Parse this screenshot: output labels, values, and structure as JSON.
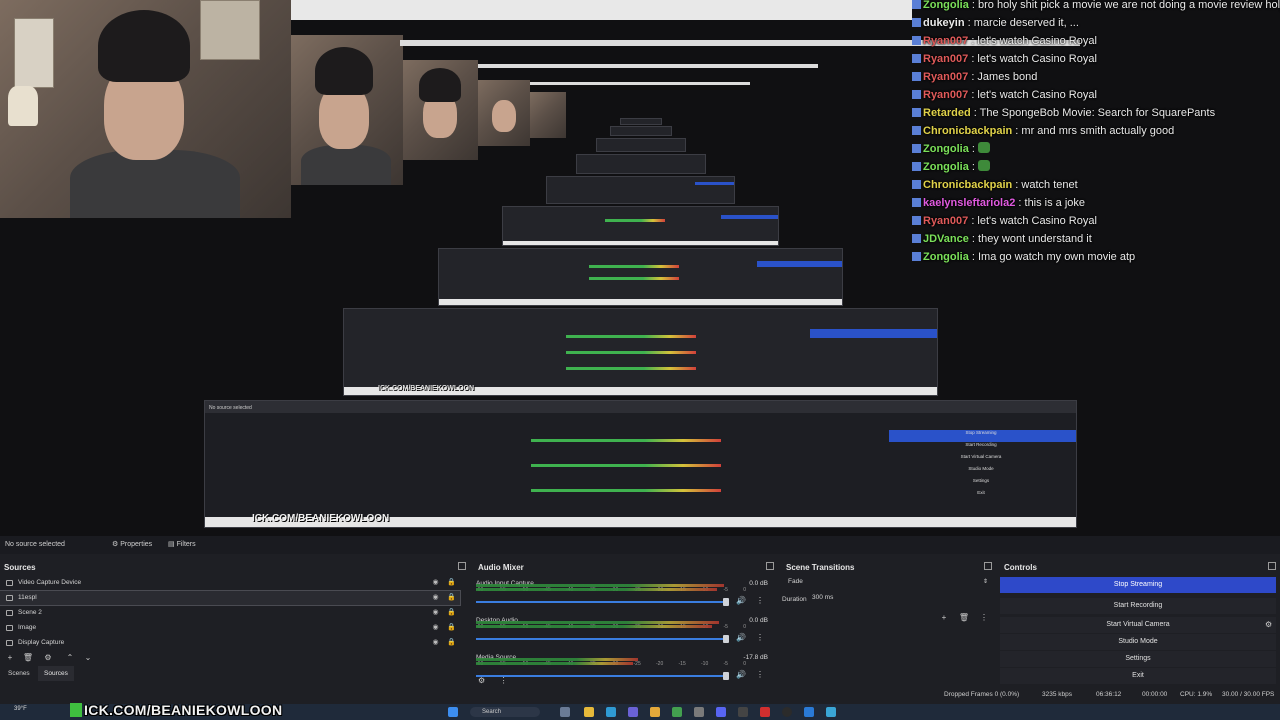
{
  "chat": {
    "lines": [
      {
        "user": "Zongolia",
        "msg": " : bro holy shit pick a movie we are not doing a movie review holy shit",
        "color": "#7be05a"
      },
      {
        "user": "dukeyin",
        "msg": " : marcie deserved it, ...",
        "color": "#eaeaea"
      },
      {
        "user": "Ryan007",
        "msg": " : let's watch Casino Royal",
        "color": "#e05a5a"
      },
      {
        "user": "Ryan007",
        "msg": " : let's watch Casino Royal",
        "color": "#e05a5a"
      },
      {
        "user": "Ryan007",
        "msg": " : James bond",
        "color": "#e05a5a"
      },
      {
        "user": "Ryan007",
        "msg": " : let's watch Casino Royal",
        "color": "#e05a5a"
      },
      {
        "user": "Retarded",
        "msg": " : The SpongeBob Movie: Search for SquarePants",
        "color": "#e0d24a"
      },
      {
        "user": "Chronicbackpain",
        "msg": " : mr and mrs smith actually good",
        "color": "#e0d24a"
      },
      {
        "user": "Zongolia",
        "msg": " : ",
        "color": "#7be05a",
        "emote": true
      },
      {
        "user": "Zongolia",
        "msg": " : ",
        "color": "#7be05a",
        "emote": true
      },
      {
        "user": "Chronicbackpain",
        "msg": " : watch tenet",
        "color": "#e0d24a"
      },
      {
        "user": "kaelynsleftariola2",
        "msg": " : this is a joke",
        "color": "#e05ae0"
      },
      {
        "user": "Ryan007",
        "msg": " : let's watch Casino Royal",
        "color": "#e05a5a"
      },
      {
        "user": "JDVance",
        "msg": " : they wont understand it",
        "color": "#7be05a"
      },
      {
        "user": "Zongolia",
        "msg": " : Ima go watch my own movie atp",
        "color": "#7be05a"
      }
    ]
  },
  "preview": {
    "overlay_url": "ICK.COM/BEANIEKOWLOON",
    "nested_no_source": "No source selected",
    "nested_controls": [
      "Stop Streaming",
      "Start Recording",
      "Start Virtual Camera",
      "Studio Mode",
      "Settings",
      "Exit"
    ]
  },
  "toolbar": {
    "no_source": "No source selected",
    "properties": "Properties",
    "filters": "Filters"
  },
  "sources": {
    "title": "Sources",
    "items": [
      "Video Capture Device",
      "11espl",
      "Scene 2",
      "Image",
      "Display Capture"
    ],
    "tab_scenes": "Scenes",
    "tab_sources": "Sources"
  },
  "mixer": {
    "title": "Audio Mixer",
    "channels": [
      {
        "name": "Audio Input Capture",
        "db": "0.0 dB",
        "level": 0.92
      },
      {
        "name": "Desktop Audio",
        "db": "0.0 dB",
        "level": 0.9
      },
      {
        "name": "Media Source",
        "db": "-17.8 dB",
        "level": 0.6
      }
    ],
    "scale": [
      "-60",
      "-55",
      "-50",
      "-45",
      "-40",
      "-35",
      "-30",
      "-25",
      "-20",
      "-15",
      "-10",
      "-5",
      "0"
    ]
  },
  "transitions": {
    "title": "Scene Transitions",
    "type": "Fade",
    "duration_label": "Duration",
    "duration_value": "300 ms"
  },
  "controls": {
    "title": "Controls",
    "buttons": [
      "Stop Streaming",
      "Start Recording",
      "Start Virtual Camera",
      "Studio Mode",
      "Settings",
      "Exit"
    ]
  },
  "status": {
    "dropped": "Dropped Frames 0 (0.0%)",
    "kbps": "3235 kbps",
    "live_time": "06:36:12",
    "rec_time": "00:00:00",
    "cpu": "CPU: 1.9%",
    "fps": "30.00 / 30.00 FPS"
  },
  "taskbar": {
    "temp": "39°F",
    "search": "Search",
    "accent": "#2e49c9"
  }
}
